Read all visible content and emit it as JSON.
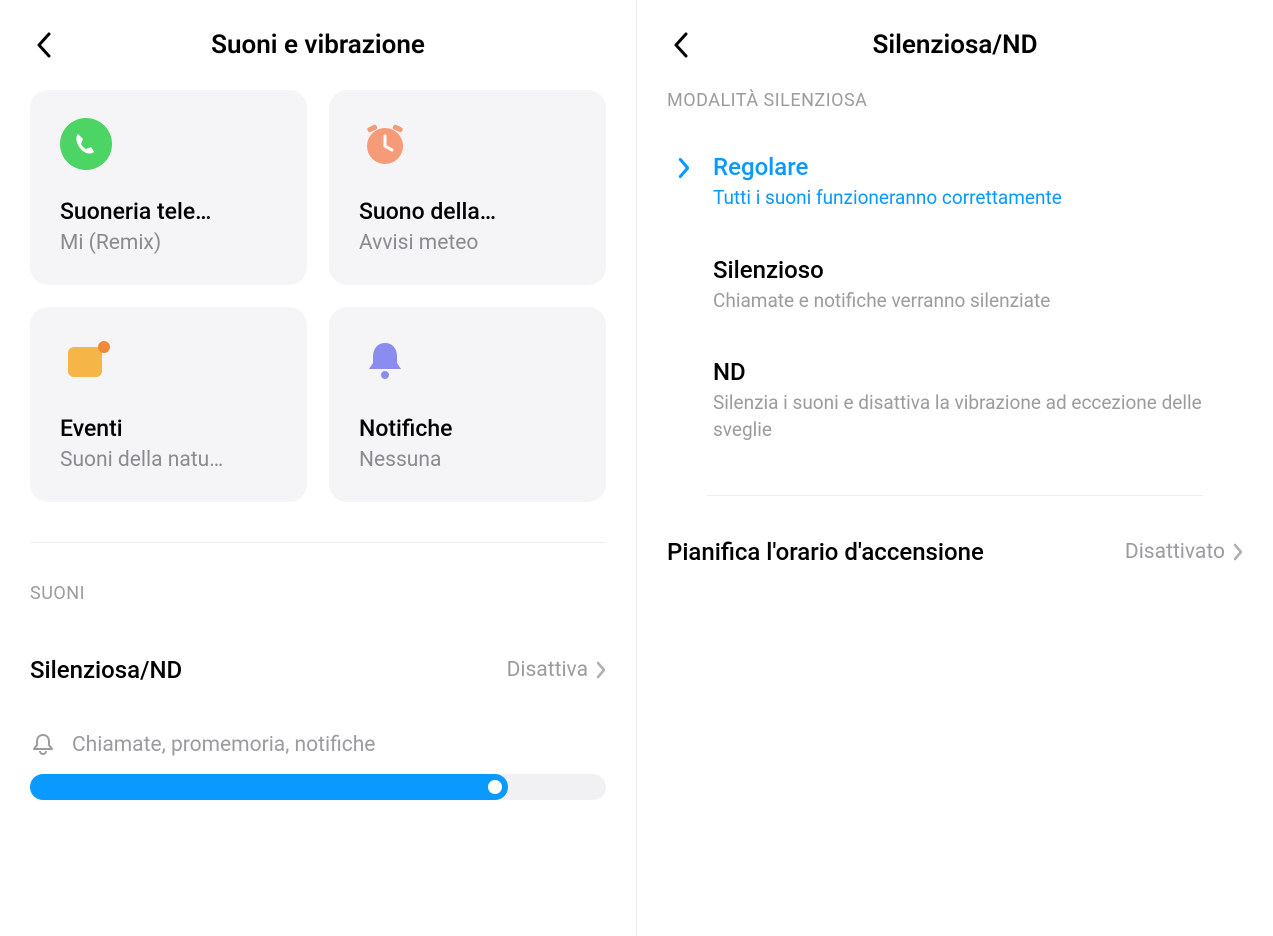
{
  "left": {
    "title": "Suoni e vibrazione",
    "tiles": [
      {
        "title": "Suoneria tele…",
        "sub": "Mi (Remix)",
        "icon": "phone",
        "color": "#4cd464"
      },
      {
        "title": "Suono della…",
        "sub": "Avvisi meteo",
        "icon": "alarm",
        "color": "#f59b77"
      },
      {
        "title": "Eventi",
        "sub": "Suoni della natu…",
        "icon": "calendar",
        "color": "#f5b547"
      },
      {
        "title": "Notifiche",
        "sub": "Nessuna",
        "icon": "bell",
        "color": "#8a8cf0"
      }
    ],
    "section_label": "SUONI",
    "silent_row": {
      "title": "Silenziosa/ND",
      "value": "Disattiva"
    },
    "slider_label": "Chiamate, promemoria, notifiche"
  },
  "right": {
    "title": "Silenziosa/ND",
    "section_label": "MODALITÀ SILENZIOSA",
    "modes": [
      {
        "title": "Regolare",
        "sub": "Tutti i suoni funzioneranno correttamente",
        "active": true
      },
      {
        "title": "Silenzioso",
        "sub": "Chiamate e notifiche verranno silenziate",
        "active": false
      },
      {
        "title": "ND",
        "sub": "Silenzia i suoni e disattiva la vibrazione ad eccezione delle sveglie",
        "active": false
      }
    ],
    "schedule": {
      "title": "Pianifica l'orario d'accensione",
      "value": "Disattivato"
    }
  }
}
